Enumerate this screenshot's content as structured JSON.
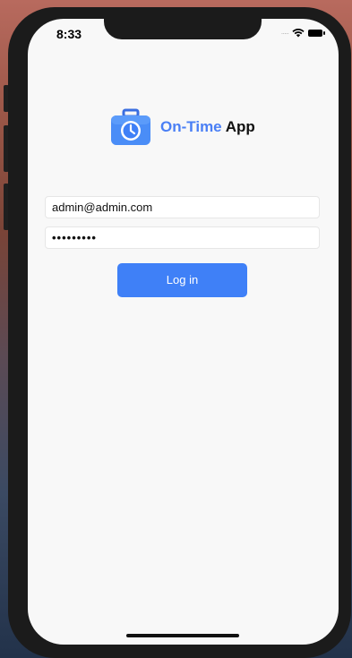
{
  "status_bar": {
    "time": "8:33",
    "signal_icon": "signal-dots-icon",
    "wifi_icon": "wifi-icon",
    "battery_icon": "battery-icon"
  },
  "logo": {
    "icon": "briefcase-clock-icon",
    "brand": "On-Time",
    "suffix": " App",
    "brand_color": "#4a7ff5"
  },
  "form": {
    "email_value": "admin@admin.com",
    "password_value": "•••••••••",
    "login_label": "Log in",
    "login_color": "#3f80f7"
  }
}
